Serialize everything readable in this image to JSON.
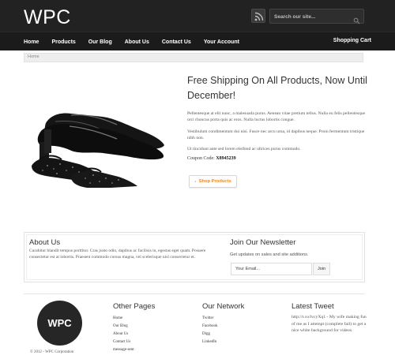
{
  "header": {
    "logo": "WPC",
    "search_placeholder": "Search our site...",
    "rss_icon": "rss-icon",
    "search_icon": "search-icon"
  },
  "nav": {
    "items": [
      "Home",
      "Products",
      "Our Blog",
      "About Us",
      "Contact Us",
      "Your Account"
    ],
    "cart": "Shopping Cart"
  },
  "breadcrumb": "Home",
  "hero": {
    "title": "Free Shipping On All Products, Now Until December!",
    "p1": "Pellentesque at elit nunc, a malesuada purus. Aenean vitae pretium tellus. Nulla eu felis pellentesque orci rhoncus porta quis ac eros. Nulla luctus lobortis congue.",
    "p2": "Vestibulum condimentum dui nisi. Fusce nec arcu urna, id dapibus neque. Proin fermentum tristique nibh non.",
    "p3": "Ut tincidunt ante sed lorem eleifend ac ultrices purus commodo.",
    "coupon_label": "Coupon Code: ",
    "coupon_code": "X8945239",
    "button": "Shop Products",
    "image": "shoes-photo"
  },
  "about": {
    "title": "About Us",
    "text": "Curabitur blandit tempus porttitor. Cras justo odio, dapibus ac facilisis in, egestas eget quam. Posuere consectetur est at lobortis. Praesent commodo cursus magna, vel scelerisque nisl consectetur et."
  },
  "newsletter": {
    "title": "Join Our Newsletter",
    "text": "Get updates on sales and site additions.",
    "placeholder": "Your Email...",
    "button": "Join"
  },
  "footer": {
    "logo": "WPC",
    "copyright": "© 2012 - WPC Corporation",
    "other_pages": {
      "title": "Other Pages",
      "links": [
        "Home",
        "Our Blog",
        "About Us",
        "Contact Us",
        "message-sent"
      ]
    },
    "network": {
      "title": "Our Network",
      "links": [
        "Twitter",
        "Facebook",
        "Digg",
        "LinkedIn"
      ]
    },
    "tweet": {
      "title": "Latest Tweet",
      "text": "http://t.co/lvcyXq1 - My wife making fun of me as I attempt (complete fail) to get a nice white background for videos."
    }
  },
  "colors": {
    "header_bg": "#222222",
    "accent": "#e88a2a"
  }
}
